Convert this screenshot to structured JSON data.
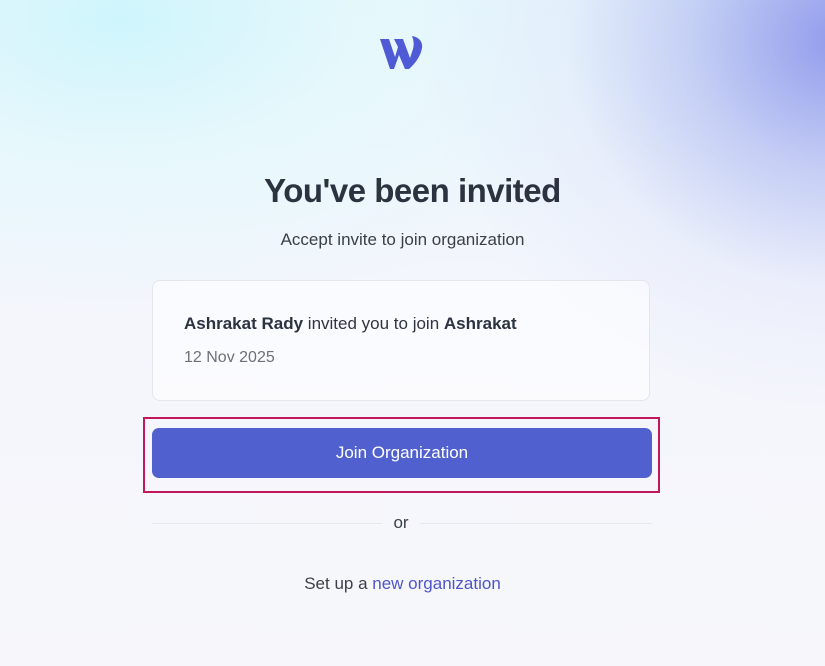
{
  "brand": {
    "logo_icon": "w-logo-icon",
    "color": "#4f5bd5"
  },
  "heading": {
    "title": "You've been invited",
    "subtitle": "Accept invite to join organization"
  },
  "invite": {
    "inviter": "Ashrakat Rady",
    "middle_text": "invited you to join",
    "organization": "Ashrakat",
    "date": "12 Nov 2025"
  },
  "actions": {
    "join_label": "Join Organization",
    "join_color": "#5060cf",
    "highlight_color": "#c2185b",
    "or_label": "or",
    "setup_prefix": "Set up a",
    "setup_link": "new organization",
    "link_color": "#4f55c9"
  }
}
